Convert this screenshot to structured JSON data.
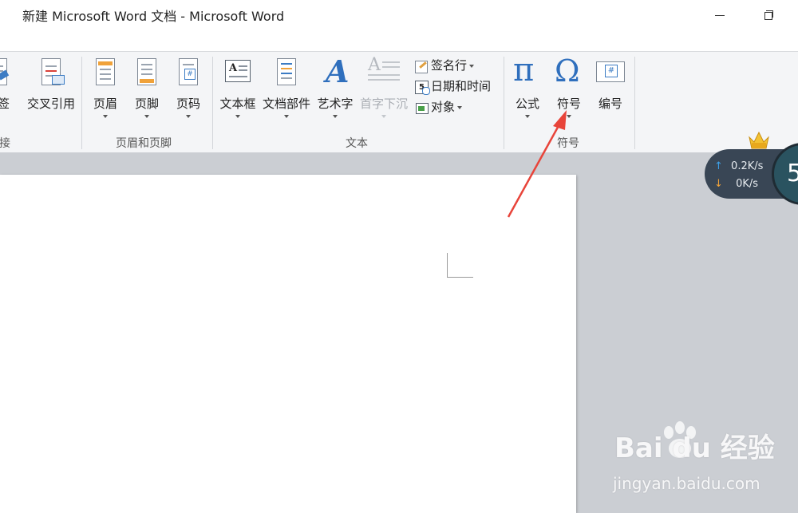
{
  "window": {
    "title": "新建 Microsoft Word 文档 - Microsoft Word"
  },
  "ribbon": {
    "groups": {
      "links": {
        "label": "链接",
        "buttons": {
          "bookmark": "书签",
          "cross_ref": "交叉引用"
        }
      },
      "header_footer": {
        "label": "页眉和页脚",
        "buttons": {
          "header": "页眉",
          "footer": "页脚",
          "page_number": "页码"
        }
      },
      "text": {
        "label": "文本",
        "buttons": {
          "text_box": "文本框",
          "quick_parts": "文档部件",
          "word_art": "艺术字",
          "drop_cap": "首字下沉"
        },
        "small_buttons": {
          "signature_line": "签名行",
          "date_time": "日期和时间",
          "object": "对象"
        }
      },
      "symbols": {
        "label": "符号",
        "buttons": {
          "equation": "公式",
          "symbol": "符号",
          "number": "编号"
        }
      }
    }
  },
  "net_monitor": {
    "upload": "0.2K/s",
    "download": "0K/s",
    "value": "5"
  },
  "watermark": {
    "brand": "Bai du 经验",
    "url": "jingyan.baidu.com"
  },
  "colors": {
    "ribbon_bg": "#f4f5f7",
    "doc_bg": "#cbced3",
    "arrow": "#e8443a",
    "net_bg": "#394655"
  }
}
